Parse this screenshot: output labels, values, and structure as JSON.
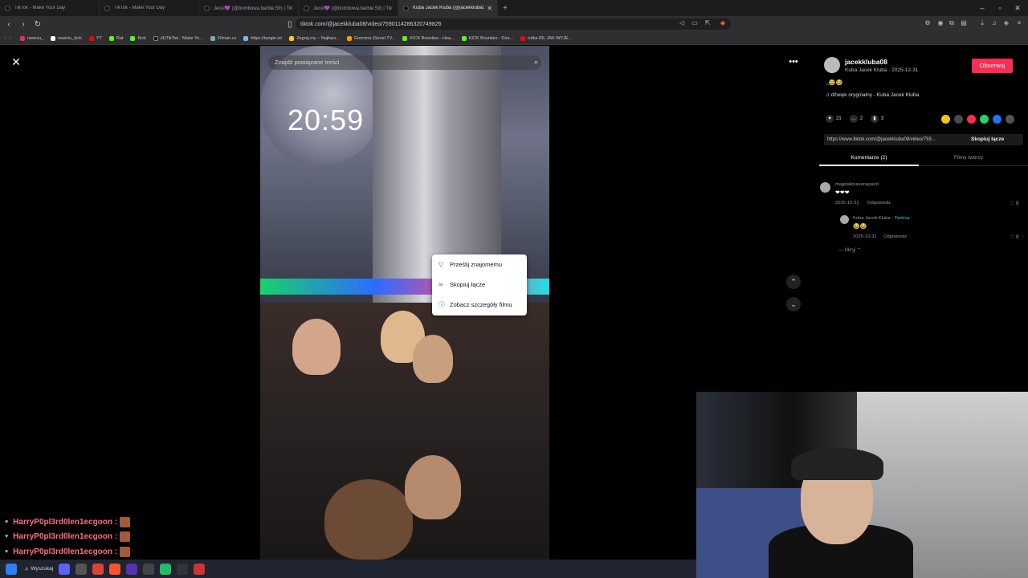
{
  "browser": {
    "tabs": [
      {
        "title": "TikTok - Make Your Day",
        "active": false
      },
      {
        "title": "TikTok - Make Your Day",
        "active": false
      },
      {
        "title": "Jessi💜 (@bombowa.barbie.59) | TikT",
        "active": false
      },
      {
        "title": "Jessi💜 (@bombowa.barbie.59) | TikT",
        "active": false
      },
      {
        "title": "Kuba Jacek Kluba (@jacekkluba08)",
        "active": true
      }
    ],
    "url": "tiktok.com/@jacekkluba08/video/7590114286320749826",
    "bookmarks": [
      "nowciu_",
      "nowciu_kick",
      "YT",
      "Rat",
      "Kick",
      "(4)TikTok - Make Yo...",
      "Filman.cc",
      "https://tangle.io/",
      "Zagraj.my – Najleps...",
      "Gomorra (Serial TV...",
      "KICK Bounties - Hea...",
      "KICK Bounties - Dea...",
      "rutka IRL JAK WYJE..."
    ]
  },
  "video": {
    "search_placeholder": "Znajdź powiązane treści",
    "overlay_time": "20:59"
  },
  "context_menu": {
    "items": [
      {
        "label": "Prześlij znajomemu",
        "icon": "send-icon"
      },
      {
        "label": "Skopiuj łącze",
        "icon": "link-icon"
      },
      {
        "label": "Zobacz szczegóły filmu",
        "icon": "info-icon"
      }
    ]
  },
  "author": {
    "username": "jacekkluba08",
    "subtitle": "Kuba Jacek Kluba · 2025-12-31",
    "follow_label": "Obserwuj",
    "description_emoji": ",,😂😂",
    "sound": "♫ dźwięk oryginalny - Kuba Jacek Kluba"
  },
  "stats": {
    "likes": "21",
    "comments": "2",
    "saves": "3"
  },
  "share_colors": [
    "#f2c418",
    "#4a4a4a",
    "#fe2c55",
    "#25d366",
    "#1877f2",
    "#555555"
  ],
  "link": {
    "url": "https://www.tiktok.com/@jacekkluba08/video/759...",
    "copy_label": "Skopiuj łącze"
  },
  "panel_tabs": {
    "comments": "Komentarze (2)",
    "creator_videos": "Filmy twórcy"
  },
  "comments": [
    {
      "user": "magdalenaxenapazd",
      "text": "❤❤❤",
      "date": "2025-12-31",
      "reply": "Odpowiedz",
      "likes": "0"
    },
    {
      "user": "Kuba Jacek Kluba",
      "creator_tag": "· Twórca",
      "text": "😂😂",
      "date": "2025-12-31",
      "reply": "Odpowiedz",
      "likes": "0"
    }
  ],
  "hide_label": "Ukryj",
  "chat": {
    "messages": [
      {
        "user": "HarryP0pl3rd0len1ecgoon"
      },
      {
        "user": "HarryP0pl3rd0len1ecgoon"
      },
      {
        "user": "HarryP0pl3rd0len1ecgoon"
      }
    ]
  },
  "taskbar": {
    "search_label": "Wyszukaj"
  }
}
